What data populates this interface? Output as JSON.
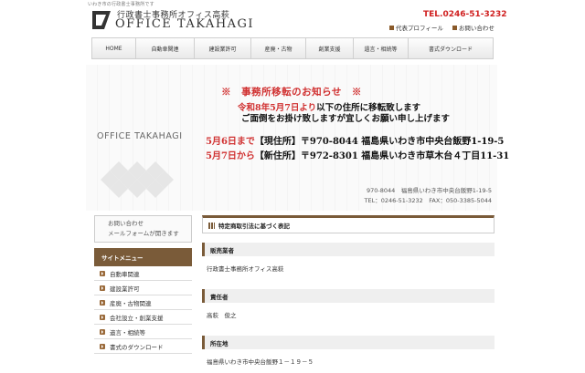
{
  "header": {
    "top_strip": "いわき市の行政書士事務所です",
    "logo_ja": "行政書士事務所オフィス高萩",
    "logo_en": "OFFICE TAKAHAGI",
    "tel": "TEL.0246-51-3232",
    "links": [
      "代表プロフィール",
      "お問い合わせ"
    ]
  },
  "nav": {
    "items": [
      "HOME",
      "自動車関連",
      "建設業許可",
      "産廃・古物",
      "創業支援",
      "遺言・相続等",
      "書式ダウンロード"
    ]
  },
  "hero": {
    "notice_title": "※　事務所移転のお知らせ　※",
    "line2_red": "令和8年5月7日より",
    "line2_black": "以下の住所に移転致します",
    "line3": "ご面倒をお掛け致しますが宜しくお願い申し上げます",
    "addr1_red": "5月6日まで",
    "addr1_black": "【現住所】〒970-8044 福島県いわき市中央台飯野1-19-5",
    "addr2_red": "5月7日から",
    "addr2_black": "【新住所】〒972-8301 福島県いわき市草木台４丁目11-31",
    "name": "OFFICE TAKAHAGI",
    "info_line1": "970-8044　福島県いわき市中央台飯野1-19-5",
    "info_line2": "TEL：0246-51-3232　FAX：050-3385-5044"
  },
  "sidebar": {
    "contact_line1": "お問い合わせ",
    "contact_line2": "メールフォームが開きます",
    "menu_title": "サイトメニュー",
    "menu_items": [
      "自動車関連",
      "建設業許可",
      "産廃・古物関連",
      "会社設立・創業支援",
      "遺言・相続等",
      "書式のダウンロード"
    ]
  },
  "content": {
    "title": "特定商取引法に基づく表記",
    "fields": [
      {
        "label": "販売業者",
        "value": "行政書士事務所オフィス高萩"
      },
      {
        "label": "責任者",
        "value": "高萩　俊之"
      },
      {
        "label": "所在地",
        "value": "福島県いわき市中央台飯野１－１９－５"
      }
    ]
  },
  "colors": {
    "accent": "#7a5b39",
    "red": "#d03030"
  }
}
